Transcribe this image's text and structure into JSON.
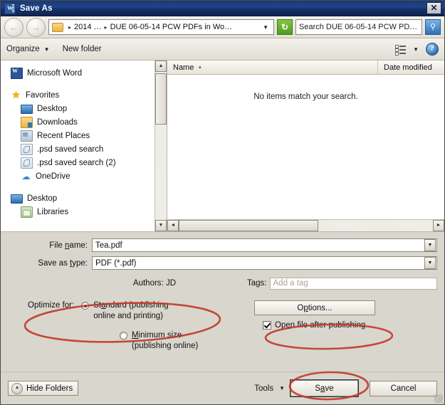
{
  "window": {
    "title": "Save As",
    "app_icon": "word-icon",
    "close_label": "✕"
  },
  "addressbar": {
    "back_icon": "←",
    "forward_icon": "→",
    "folder_icon": "folder-icon",
    "separator": "▸",
    "crumb_root": "2014 …",
    "crumb_current": "DUE 06-05-14 PCW PDFs in Wo…",
    "dropdown_caret": "▼",
    "refresh_icon": "↻",
    "search_value": "Search DUE 06-05-14 PCW PD…",
    "search_icon": "search-icon"
  },
  "toolbar": {
    "organize_label": "Organize",
    "organize_caret": "▼",
    "new_folder_label": "New folder",
    "view_caret": "▼",
    "help_label": "?"
  },
  "navpane": {
    "items": [
      {
        "label": "Microsoft Word",
        "icon": "word-icon",
        "indent": false,
        "gap_after": true
      },
      {
        "label": "Favorites",
        "icon": "star-icon",
        "indent": false,
        "gap_after": false
      },
      {
        "label": "Desktop",
        "icon": "monitor-icon",
        "indent": true,
        "gap_after": false
      },
      {
        "label": "Downloads",
        "icon": "downloads-icon",
        "indent": true,
        "gap_after": false
      },
      {
        "label": "Recent Places",
        "icon": "recent-places-icon",
        "indent": true,
        "gap_after": false
      },
      {
        "label": ".psd saved search",
        "icon": "saved-search-icon",
        "indent": true,
        "gap_after": false
      },
      {
        "label": ".psd saved search (2)",
        "icon": "saved-search-icon",
        "indent": true,
        "gap_after": false
      },
      {
        "label": "OneDrive",
        "icon": "cloud-icon",
        "indent": true,
        "gap_after": true
      },
      {
        "label": "Desktop",
        "icon": "monitor-icon",
        "indent": false,
        "gap_after": false
      },
      {
        "label": "Libraries",
        "icon": "library-icon",
        "indent": true,
        "gap_after": false
      }
    ],
    "scroll_up": "▲",
    "scroll_down": "▼"
  },
  "filelist": {
    "columns": [
      "Name",
      "Date modified"
    ],
    "sort_indicator": "▲",
    "empty_message": "No items match your search.",
    "rows": [],
    "hscroll_left": "◄",
    "hscroll_right": "►"
  },
  "form": {
    "filename_label_a": "File ",
    "filename_label_accel": "n",
    "filename_label_b": "ame:",
    "filename_value": "Tea.pdf",
    "savetype_label_a": "Save as ",
    "savetype_label_accel": "t",
    "savetype_label_b": "ype:",
    "savetype_value": "PDF (*.pdf)",
    "dropdown_caret": "▼",
    "authors_label": "Authors:",
    "authors_value": "JD",
    "tags_label": "Tags:",
    "tags_placeholder": "Add a tag"
  },
  "optimize": {
    "label": "Optimize for:",
    "standard_a": "St",
    "standard_accel": "a",
    "standard_b": "ndard (publishing",
    "standard_line2": "online and printing)",
    "standard_selected": true,
    "minimum_a": "",
    "minimum_accel": "M",
    "minimum_b": "inimum size",
    "minimum_line2": "(publishing online)",
    "minimum_selected": false,
    "options_button_a": "O",
    "options_button_accel": "p",
    "options_button_b": "tions...",
    "openfile_a": "Op",
    "openfile_accel": "e",
    "openfile_b": "n file after publishing",
    "openfile_checked": true
  },
  "footer": {
    "hide_folders_label": "Hide Folders",
    "hide_folders_icon": "▲",
    "tools_label": "Tools",
    "tools_caret": "▼",
    "save_a": "S",
    "save_accel": "a",
    "save_b": "ve",
    "cancel_label": "Cancel"
  },
  "annotations": {
    "accent_color": "#c0392b",
    "marks": [
      "optimize-standard-ellipse",
      "open-file-after-publishing-ellipse",
      "save-button-ellipse"
    ]
  }
}
